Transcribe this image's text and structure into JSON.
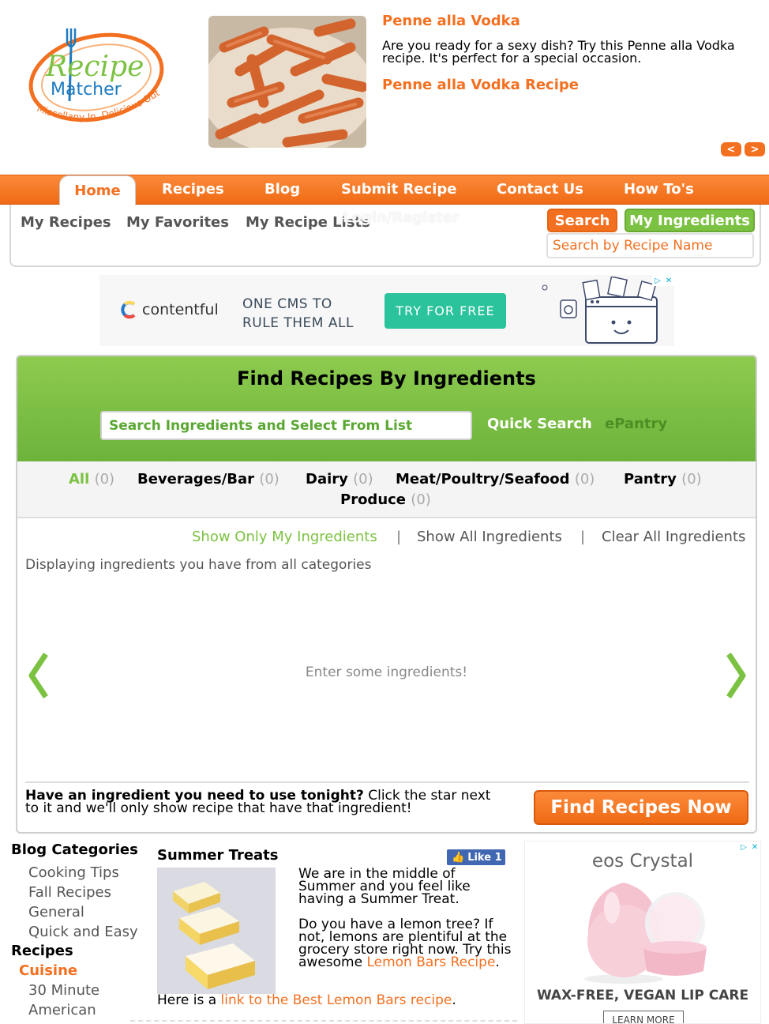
{
  "header": {
    "logo": {
      "word1": "Recipe",
      "word2": "Matcher",
      "tagline": "Miscellany In, Delicious Out"
    },
    "feature": {
      "title": "Penne alla Vodka",
      "text": "Are you ready for a sexy dish? Try this Penne alla Vodka recipe. It's perfect for a special occasion.",
      "link": "Penne alla Vodka Recipe",
      "prev": "<",
      "next": ">"
    }
  },
  "nav": {
    "home": "Home",
    "recipes": "Recipes",
    "blog": "Blog",
    "submit": "Submit Recipe",
    "contact": "Contact Us",
    "howto": "How To's"
  },
  "subnav": {
    "my_recipes": "My Recipes",
    "my_favorites": "My Favorites",
    "my_recipe_lists": "My Recipe Lists",
    "login": "Login/Register",
    "search_button": "Search",
    "my_ingredients_button": "My Ingredients",
    "search_placeholder": "Search by Recipe Name"
  },
  "ad_top": {
    "brand": "contentful",
    "tagline_1": "ONE CMS TO",
    "tagline_2": "RULE THEM ALL",
    "button": "TRY FOR FREE",
    "colors": {
      "button": "#2bc39b"
    }
  },
  "finder": {
    "title": "Find Recipes By Ingredients",
    "input_placeholder": "Search Ingredients and Select From List",
    "quick_search": "Quick Search",
    "epantry": "ePantry",
    "categories": [
      {
        "label": "All",
        "count": "(0)"
      },
      {
        "label": "Beverages/Bar",
        "count": "(0)"
      },
      {
        "label": "Dairy",
        "count": "(0)"
      },
      {
        "label": "Meat/Poultry/Seafood",
        "count": "(0)"
      },
      {
        "label": "Pantry",
        "count": "(0)"
      },
      {
        "label": "Produce",
        "count": "(0)"
      }
    ],
    "show_only_mine": "Show Only My Ingredients",
    "show_all": "Show All Ingredients",
    "clear_all": "Clear All Ingredients",
    "separator": "|",
    "displaying": "Displaying ingredients you have from all categories",
    "empty_message": "Enter some ingredients!",
    "tonight_bold": "Have an ingredient you need to use tonight?",
    "tonight_rest": " Click the star next to it and we'll only show recipe that have that ingredient!",
    "find_button": "Find Recipes Now"
  },
  "sidebar": {
    "blog_categories_heading": "Blog Categories",
    "blog_categories": [
      "Cooking Tips",
      "Fall Recipes",
      "General",
      "Quick and Easy"
    ],
    "recipes_heading": "Recipes",
    "cuisine_heading": "Cuisine",
    "cuisine_items": [
      "30 Minute",
      "American"
    ]
  },
  "post": {
    "title": "Summer Treats",
    "like": "Like 1",
    "para1": "We are in the middle of Summer and you feel like having a Summer Treat.",
    "para2": "Do you have a lemon tree?  If not, lemons are plentiful at the grocery store right now.  Try this awesome ",
    "para2_link": "Lemon Bars Recipe",
    "para2_end": ".",
    "link_line_prefix": "Here is a ",
    "link_line_link": "link to the Best Lemon Bars recipe",
    "link_line_suffix": "."
  },
  "ad_side": {
    "brand": "eos Crystal",
    "tagline": "WAX-FREE, VEGAN LIP CARE",
    "button": "LEARN MORE"
  },
  "colors": {
    "orange": "#f37021",
    "green": "#7cc242"
  }
}
